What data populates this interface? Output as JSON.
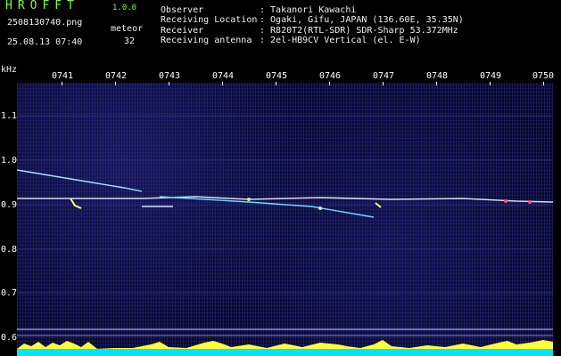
{
  "header": {
    "app_title": "HROFFT",
    "app_version": "1.0.0",
    "file_name": "2508130740.png",
    "datetime": "25.08.13 07:40",
    "meteor_label": "meteor",
    "meteor_count": "32"
  },
  "info": [
    {
      "key": "Observer",
      "value": ": Takanori Kawachi"
    },
    {
      "key": "Receiving Location",
      "value": ": Ogaki, Gifu, JAPAN (136.60E, 35.35N)"
    },
    {
      "key": "Receiver",
      "value": ": R820T2(RTL-SDR) SDR-Sharp 53.372MHz"
    },
    {
      "key": "Receiving antenna",
      "value": ": 2el-HB9CV Vertical (el. E-W)"
    }
  ],
  "axes": {
    "unit": "kHz",
    "time_ticks": [
      "0741",
      "0742",
      "0743",
      "0744",
      "0745",
      "0746",
      "0747",
      "0748",
      "0749",
      "0750"
    ],
    "freq_ticks": [
      "1.1",
      "1.0",
      "0.9",
      "0.8",
      "0.7",
      "0.6"
    ]
  },
  "colors": {
    "accent_green": "#7CFF3A",
    "plot_bg": "#06062a",
    "carrier": "#ffffff",
    "meteor_trail": "#6fd8ff",
    "level_bar_fill": "#ffff33",
    "level_bar_base": "#00e5ff"
  }
}
